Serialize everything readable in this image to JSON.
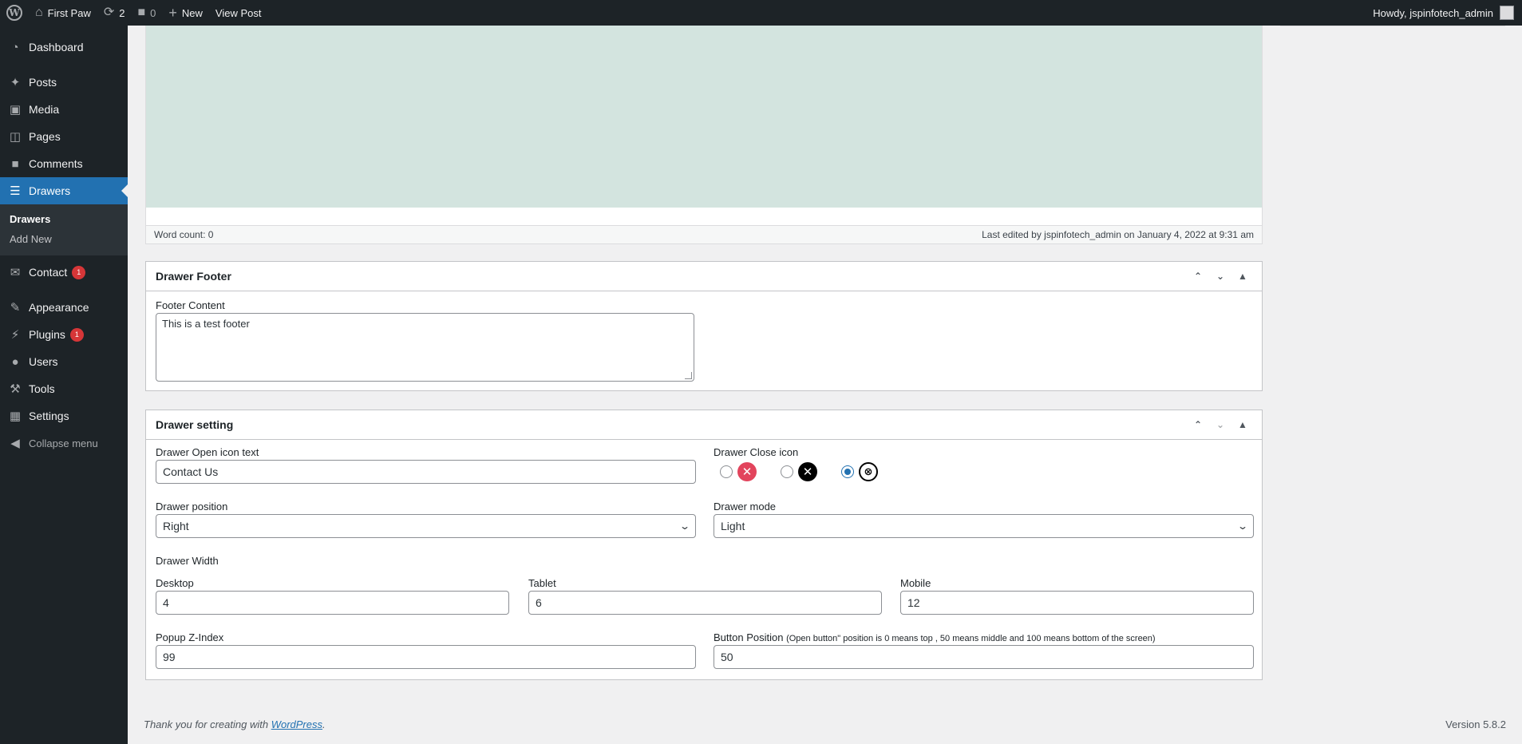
{
  "admin_bar": {
    "site_name": "First Paw",
    "updates_count": "2",
    "comments_count": "0",
    "new_label": "New",
    "view_post_label": "View Post",
    "howdy": "Howdy, jspinfotech_admin"
  },
  "sidebar": {
    "dashboard": "Dashboard",
    "posts": "Posts",
    "media": "Media",
    "pages": "Pages",
    "comments": "Comments",
    "drawers": "Drawers",
    "sub_drawers": "Drawers",
    "sub_add_new": "Add New",
    "contact": "Contact",
    "contact_badge": "1",
    "appearance": "Appearance",
    "plugins": "Plugins",
    "plugins_badge": "1",
    "users": "Users",
    "tools": "Tools",
    "settings": "Settings",
    "collapse": "Collapse menu"
  },
  "editor": {
    "word_count": "Word count: 0",
    "last_edited": "Last edited by jspinfotech_admin on January 4, 2022 at 9:31 am"
  },
  "footer_box": {
    "title": "Drawer Footer",
    "content_label": "Footer Content",
    "content_value": "This is a test footer"
  },
  "settings_box": {
    "title": "Drawer setting",
    "open_icon_text_label": "Drawer Open icon text",
    "open_icon_text_value": "Contact Us",
    "close_icon_label": "Drawer Close icon",
    "close_icon_selected": 3,
    "position_label": "Drawer position",
    "position_value": "Right",
    "mode_label": "Drawer mode",
    "mode_value": "Light",
    "width_label": "Drawer Width",
    "desktop_label": "Desktop",
    "desktop_value": "4",
    "tablet_label": "Tablet",
    "tablet_value": "6",
    "mobile_label": "Mobile",
    "mobile_value": "12",
    "zindex_label": "Popup Z-Index",
    "zindex_value": "99",
    "button_position_label": "Button Position",
    "button_position_hint": "(Open button\" position is 0 means top , 50 means middle and 100 means bottom of the screen)",
    "button_position_value": "50"
  },
  "page_footer": {
    "thanks_prefix": "Thank you for creating with",
    "wordpress_link": "WordPress",
    "thanks_suffix": ".",
    "version": "Version 5.8.2"
  }
}
